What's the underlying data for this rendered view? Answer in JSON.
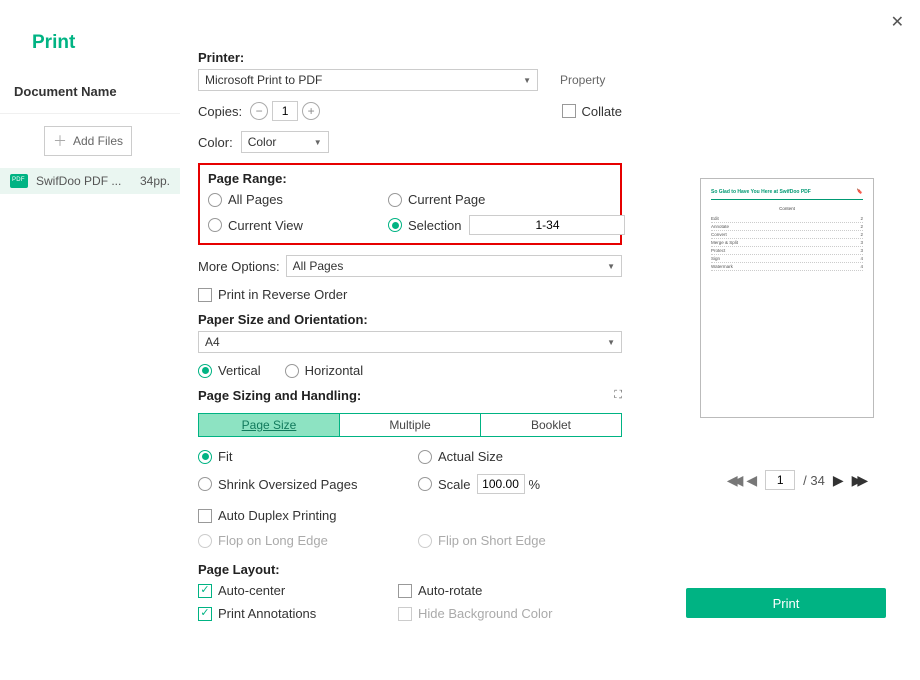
{
  "title": "Print",
  "left": {
    "doc_header": "Document Name",
    "add_files": "Add Files",
    "file_name": "SwifDoo PDF ...",
    "file_pages": "34pp."
  },
  "printer": {
    "label": "Printer:",
    "value": "Microsoft Print to PDF",
    "property": "Property"
  },
  "copies": {
    "label": "Copies:",
    "value": "1",
    "collate": "Collate"
  },
  "color": {
    "label": "Color:",
    "value": "Color"
  },
  "page_range": {
    "label": "Page Range:",
    "all": "All Pages",
    "current_page": "Current Page",
    "current_view": "Current View",
    "selection": "Selection",
    "selection_value": "1-34"
  },
  "more_options": {
    "label": "More Options:",
    "value": "All Pages"
  },
  "reverse": "Print in Reverse Order",
  "paper": {
    "label": "Paper Size and Orientation:",
    "value": "A4",
    "vertical": "Vertical",
    "horizontal": "Horizontal"
  },
  "sizing": {
    "label": "Page Sizing and Handling:",
    "tabs": {
      "size": "Page Size",
      "multiple": "Multiple",
      "booklet": "Booklet"
    },
    "fit": "Fit",
    "actual": "Actual Size",
    "shrink": "Shrink Oversized Pages",
    "scale": "Scale",
    "scale_value": "100.00",
    "scale_unit": "%"
  },
  "duplex": {
    "auto": "Auto Duplex Printing",
    "long": "Flop on Long Edge",
    "short": "Flip on Short Edge"
  },
  "layout": {
    "label": "Page Layout:",
    "auto_center": "Auto-center",
    "auto_rotate": "Auto-rotate",
    "annotations": "Print Annotations",
    "hide_bg": "Hide Background Color"
  },
  "pager": {
    "current": "1",
    "total": "/ 34"
  },
  "print_button": "Print",
  "preview": {
    "title": "So Glad to Have You Here at SwifDoo PDF",
    "head": "Content",
    "rows": [
      [
        "Edit",
        "2"
      ],
      [
        "Annotate",
        "2"
      ],
      [
        "Convert",
        "2"
      ],
      [
        "Merge & Split",
        "3"
      ],
      [
        "Protect",
        "3"
      ],
      [
        "Sign",
        "4"
      ],
      [
        "Watermark",
        "4"
      ]
    ]
  }
}
